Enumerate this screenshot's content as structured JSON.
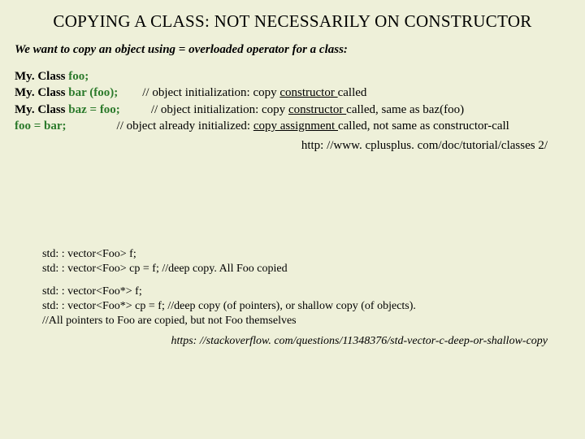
{
  "title": "COPYING A CLASS: NOT NECESSARILY ON CONSTRUCTOR",
  "intro": "We want to copy an object using  =  overloaded operator for a class:",
  "code": {
    "l1_cls": "My. Class ",
    "l1_var": "foo;",
    "l2_cls": "My. Class ",
    "l2_var": "bar (foo);",
    "l2_cm_a": "// object initialization: copy ",
    "l2_cm_u": "constructor ",
    "l2_cm_b": "called",
    "l3_cls": "My. Class ",
    "l3_var": "baz = foo;",
    "l3_cm_a": "// object initialization: copy ",
    "l3_cm_u": "constructor ",
    "l3_cm_b": "called, same as baz(foo)",
    "l4_var": "foo = bar;",
    "l4_cm_a": "// object already initialized: ",
    "l4_cm_u": "copy assignment ",
    "l4_cm_b": "called, not same as constructor-call"
  },
  "link1": "http: //www. cplusplus. com/doc/tutorial/classes 2/",
  "vec": {
    "a1": "std: : vector<Foo> f;",
    "a2": "std: : vector<Foo> cp = f; //deep copy. All Foo copied",
    "b1": "std: : vector<Foo*> f;",
    "b2": "std: : vector<Foo*> cp = f; //deep copy (of pointers), or shallow copy (of objects).",
    "b3": "//All pointers to Foo are copied, but not Foo themselves"
  },
  "link2": "https: //stackoverflow. com/questions/11348376/std-vector-c-deep-or-shallow-copy"
}
